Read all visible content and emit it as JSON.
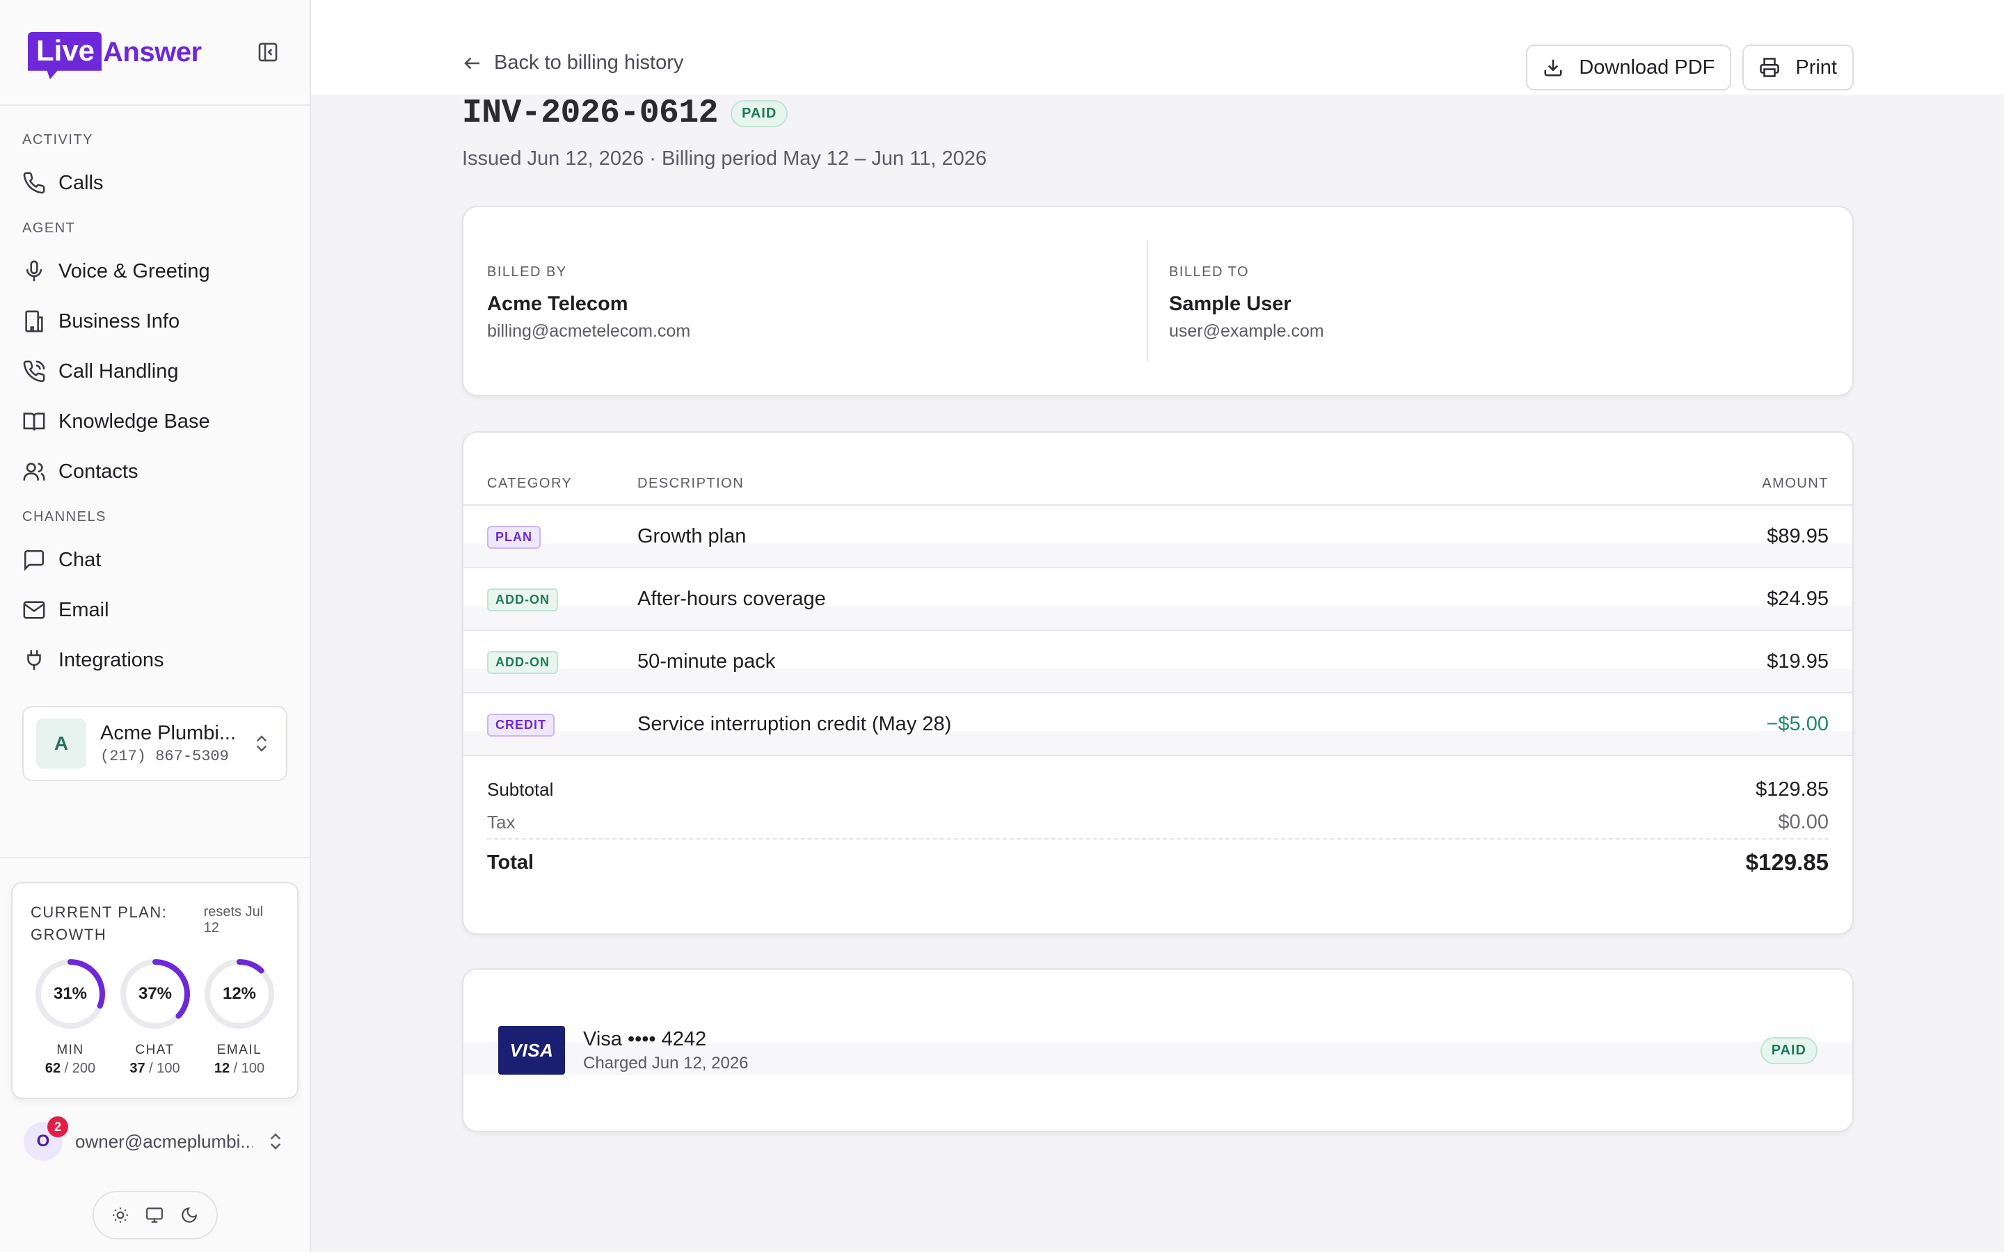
{
  "brand": {
    "logo_part1": "Live",
    "logo_part2": "Answer",
    "accent": "#6d28d9"
  },
  "sidebar": {
    "sections": [
      {
        "label": "ACTIVITY",
        "items": [
          {
            "label": "Calls",
            "icon": "phone-icon"
          }
        ]
      },
      {
        "label": "AGENT",
        "items": [
          {
            "label": "Voice & Greeting",
            "icon": "microphone-icon"
          },
          {
            "label": "Business Info",
            "icon": "building-icon"
          },
          {
            "label": "Call Handling",
            "icon": "phone-forward-icon"
          },
          {
            "label": "Knowledge Base",
            "icon": "book-icon"
          },
          {
            "label": "Contacts",
            "icon": "users-icon"
          }
        ]
      },
      {
        "label": "CHANNELS",
        "items": [
          {
            "label": "Chat",
            "icon": "chat-icon"
          },
          {
            "label": "Email",
            "icon": "mail-icon"
          },
          {
            "label": "Integrations",
            "icon": "plug-icon"
          }
        ]
      }
    ],
    "account": {
      "initial": "A",
      "name": "Acme Plumbi...",
      "phone": "(217) 867-5309"
    },
    "plan": {
      "title": "CURRENT PLAN: GROWTH",
      "resets": "resets Jul 12",
      "gauges": [
        {
          "label": "MIN",
          "percent_text": "31%",
          "fraction": 0.31,
          "used": "62",
          "limit": "/ 200"
        },
        {
          "label": "CHAT",
          "percent_text": "37%",
          "fraction": 0.37,
          "used": "37",
          "limit": "/ 100"
        },
        {
          "label": "EMAIL",
          "percent_text": "12%",
          "fraction": 0.12,
          "used": "12",
          "limit": "/ 100"
        }
      ]
    },
    "user": {
      "initial": "O",
      "notifications": "2",
      "email": "owner@acmeplumbi..."
    }
  },
  "header": {
    "back_label": "Back to billing history",
    "download_label": "Download PDF",
    "print_label": "Print"
  },
  "invoice": {
    "number": "INV-2026-0612",
    "status": "PAID",
    "subtitle": "Issued Jun 12, 2026 · Billing period May 12 – Jun 11, 2026",
    "billed_by": {
      "label": "BILLED BY",
      "name": "Acme Telecom",
      "email": "billing@acmetelecom.com"
    },
    "billed_to": {
      "label": "BILLED TO",
      "name": "Sample User",
      "email": "user@example.com"
    },
    "columns": {
      "category": "CATEGORY",
      "description": "DESCRIPTION",
      "amount": "AMOUNT"
    },
    "lines": [
      {
        "category": "PLAN",
        "description": "Growth plan",
        "amount": "$89.95"
      },
      {
        "category": "ADD-ON",
        "description": "After-hours coverage",
        "amount": "$24.95"
      },
      {
        "category": "ADD-ON",
        "description": "50-minute pack",
        "amount": "$19.95"
      },
      {
        "category": "CREDIT",
        "description": "Service interruption credit (May 28)",
        "amount": "−$5.00"
      }
    ],
    "subtotal_label": "Subtotal",
    "subtotal": "$129.85",
    "tax_label": "Tax",
    "tax": "$0.00",
    "total_label": "Total",
    "total": "$129.85",
    "payment": {
      "brand": "VISA",
      "card": "Visa •••• 4242",
      "charged": "Charged Jun 12, 2026",
      "status": "PAID"
    }
  }
}
